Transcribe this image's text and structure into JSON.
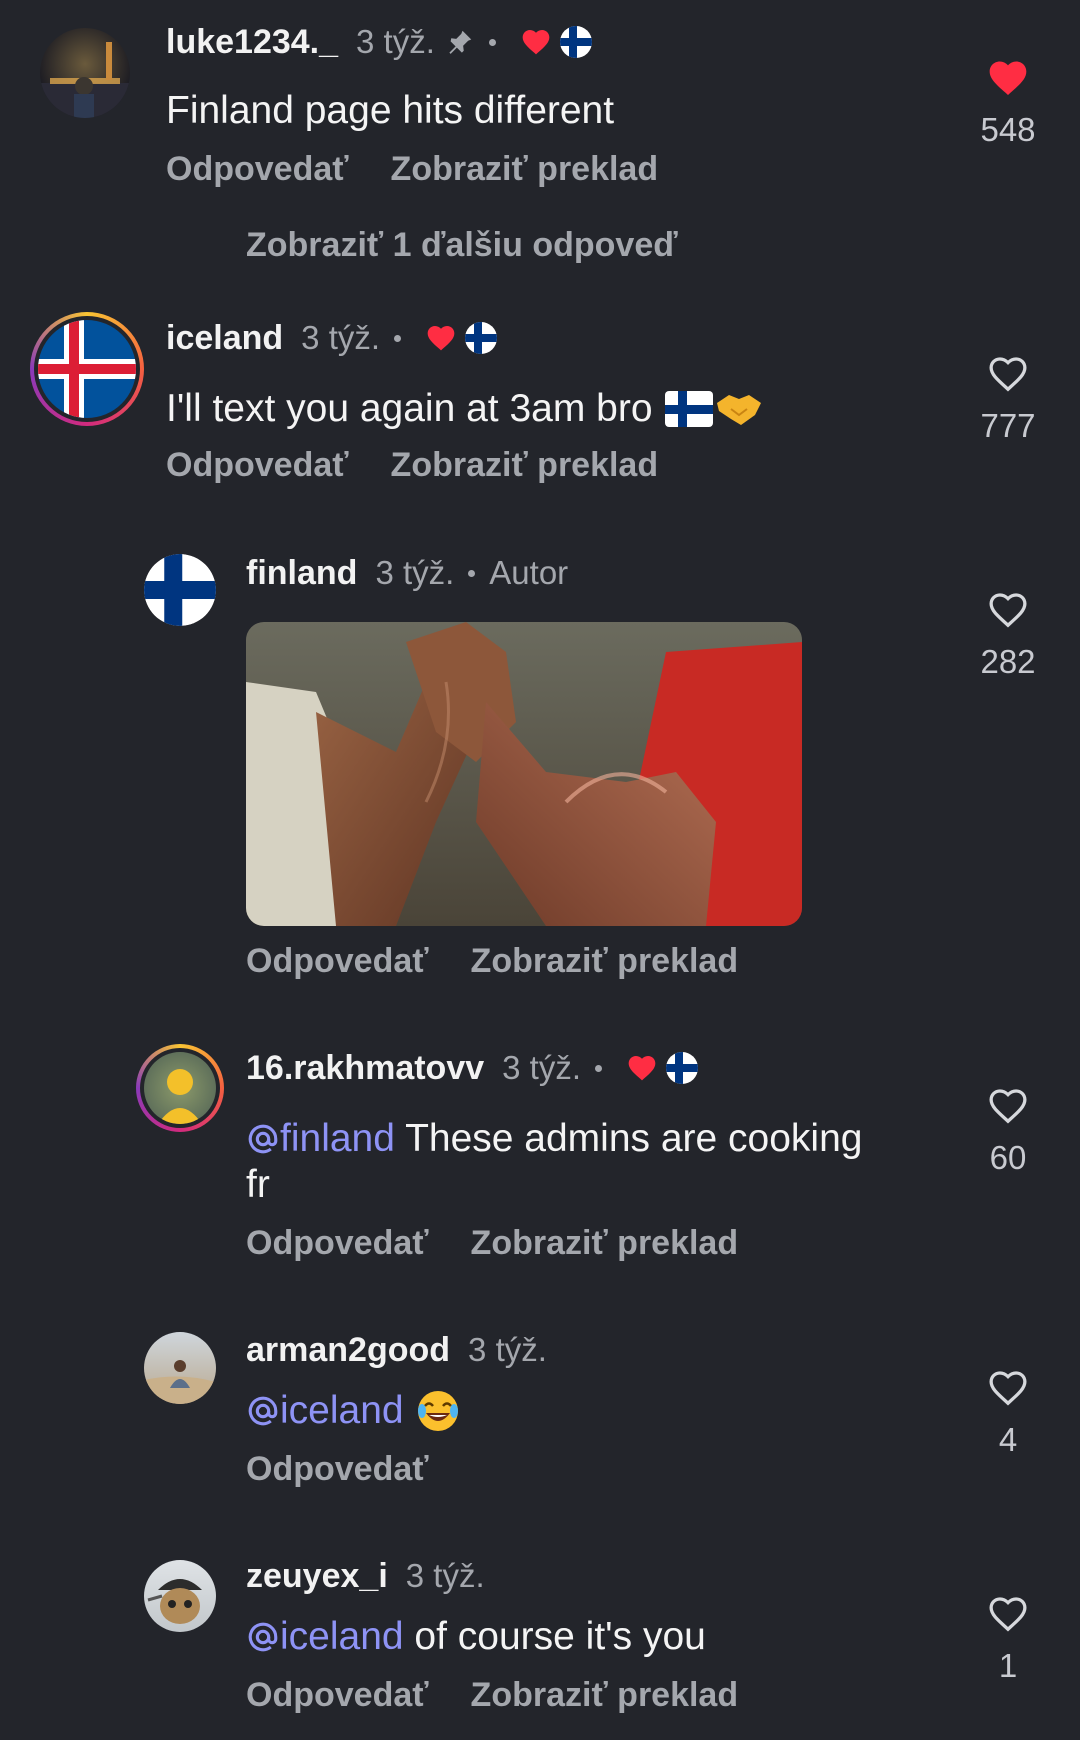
{
  "labels": {
    "reply": "Odpovedať",
    "translate": "Zobraziť preklad",
    "author": "Autor"
  },
  "colors": {
    "background": "#23252b",
    "heart_liked": "#ff2d43",
    "mention": "#8e93f5",
    "secondary_text": "#a4a7ad"
  },
  "comments": [
    {
      "username": "luke1234._",
      "time": "3 týž.",
      "pinned": true,
      "liked_by_author": true,
      "text": "Finland page hits different",
      "likes": "548",
      "liked": true,
      "more_replies": "Zobraziť 1 ďalšiu odpoveď"
    },
    {
      "username": "iceland",
      "time": "3 týž.",
      "liked_by_author": true,
      "text": "I'll text you again at 3am bro",
      "text_emoji": [
        "flag-finland",
        "handshake"
      ],
      "likes": "777",
      "liked": false
    },
    {
      "username": "finland",
      "time": "3 týž.",
      "is_author": true,
      "media": "gif-handshake-arms",
      "likes": "282",
      "liked": false
    },
    {
      "username": "16.rakhmatovv",
      "time": "3 týž.",
      "liked_by_author": true,
      "mention": "@finland",
      "text_line1": " These admins are cooking",
      "text_line2": "fr",
      "likes": "60",
      "liked": false
    },
    {
      "username": "arman2good",
      "time": "3 týž.",
      "mention": "@iceland",
      "text_emoji": [
        "face-with-tears-of-joy"
      ],
      "likes": "4",
      "liked": false,
      "actions": [
        "reply"
      ]
    },
    {
      "username": "zeuyex_i",
      "time": "3 týž.",
      "mention": "@iceland",
      "text": " of course it's you",
      "likes": "1",
      "liked": false
    }
  ]
}
